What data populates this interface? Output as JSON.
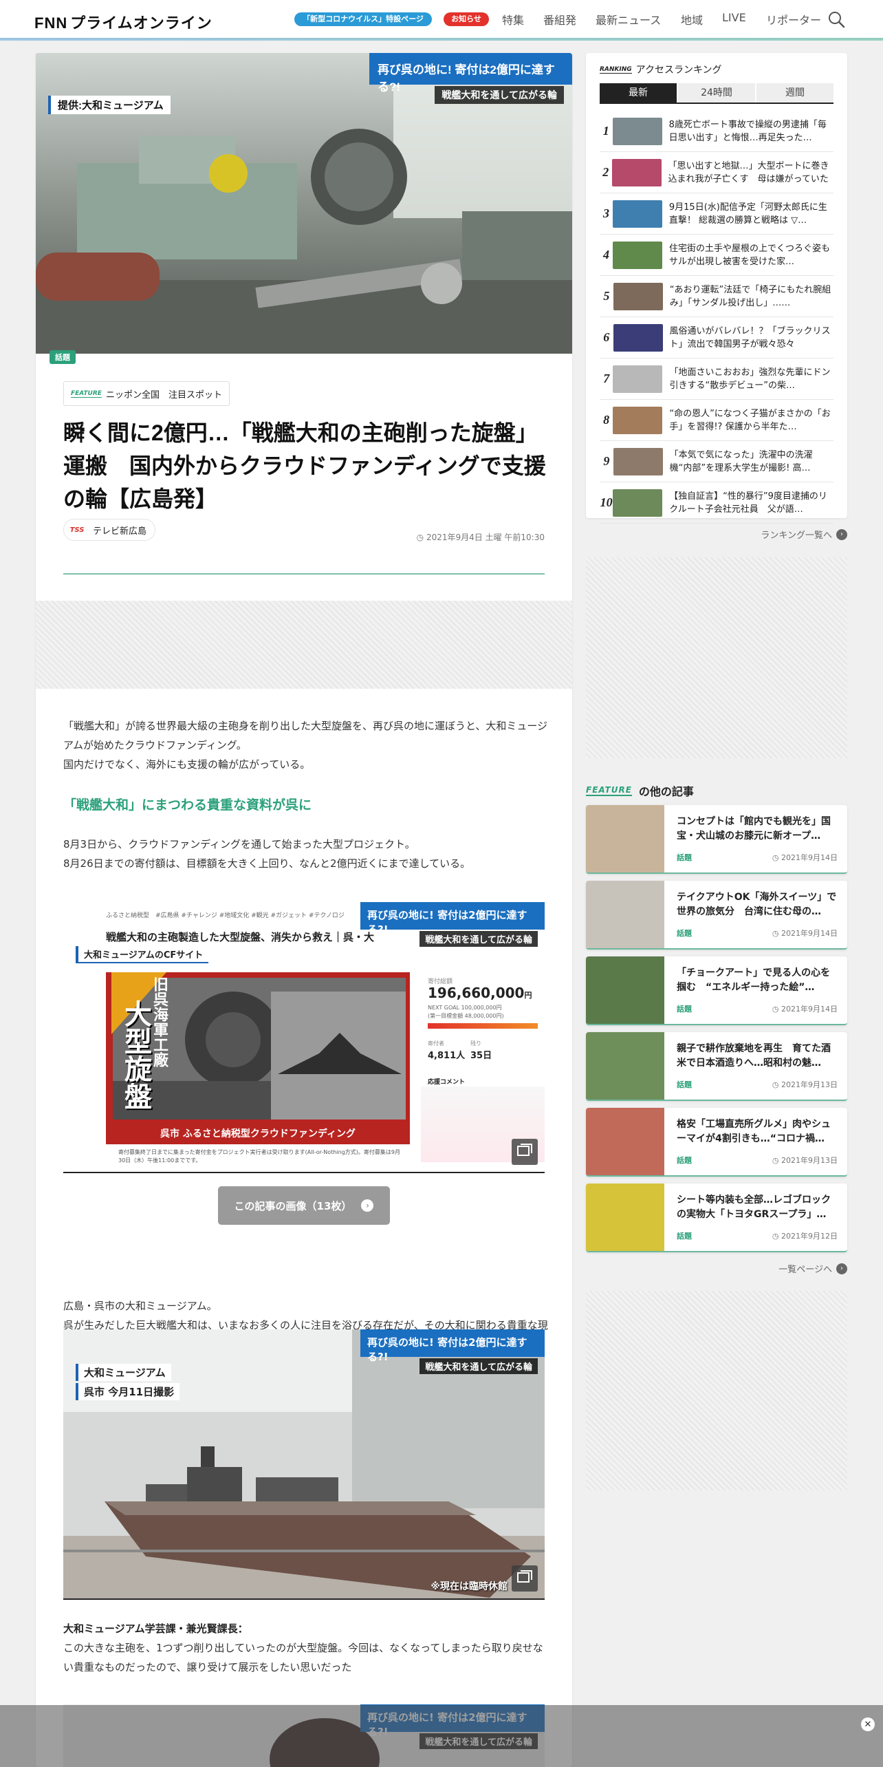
{
  "header": {
    "logo_fnn": "FNN",
    "logo_text": "プライムオンライン",
    "corona_pill": "「新型コロナウイルス」特設ページ",
    "notice_pill": "お知らせ",
    "nav": [
      "特集",
      "番組発",
      "最新ニュース",
      "地域",
      "LIVE",
      "リポーター"
    ]
  },
  "article": {
    "hero": {
      "caption": "提供:大和ミュージアム",
      "banner": "再び呉の地に! 寄付は2億円に達する?!",
      "banner_sub": "戦艦大和を通して広がる輪",
      "topic_badge": "話題"
    },
    "feature_label": "FEATURE",
    "feature_tag": "ニッポン全国　注目スポット",
    "title": "瞬く間に2億円…「戦艦大和の主砲削った旋盤」運搬　国内外からクラウドファンディングで支援の輪【広島発】",
    "source": "テレビ新広島",
    "source_logo": "TSS",
    "date": "2021年9月4日 土曜 午前10:30",
    "lead": "「戦艦大和」が誇る世界最大級の主砲身を削り出した大型旋盤を、再び呉の地に運ぼうと、大和ミュージアムが始めたクラウドファンディング。\n国内だけでなく、海外にも支援の輪が広がっている。",
    "subhead": "「戦艦大和」にまつわる貴重な資料が呉に",
    "para2": "8月3日から、クラウドファンディングを通して始まった大型プロジェクト。\n8月26日までの寄付額は、目標額を大きく上回り、なんと2億円近くにまで達している。",
    "cf_image": {
      "tags": "ふるさと納税型　#広島県 #チャレンジ #地域文化 #観光 #ガジェット #テクノロジ",
      "headline": "戦艦大和の主砲製造した大型旋盤、消失から救え｜呉・大",
      "site_label": "大和ミュージアムのCFサイト",
      "panel_side": "旧呉海軍工廠",
      "panel_big": "大型旋盤",
      "panel_bottom": "呉市 ふるさと納税型クラウドファンディング",
      "amount_label": "寄付総額",
      "amount": "196,660,000",
      "amount_unit": "円",
      "next_goal": "NEXT GOAL 100,000,000円",
      "first_goal": "(第一目標金額 48,000,000円)",
      "supporters_label": "寄付者",
      "supporters": "4,811人",
      "remaining_label": "残り",
      "remaining": "35日",
      "comment_label": "応援コメント",
      "fine_print": "寄付募集終了日までに集まった寄付金をプロジェクト実行者は受け取ります(All-or-Nothing方式)。寄付募集は9月30日（木）午後11:00までです。"
    },
    "image_count_btn": "この記事の画像（13枚）",
    "para3": "広島・呉市の大和ミュージアム。\n呉が生みだした巨大戦艦大和は、いまなお多くの人に注目を浴びる存在だが、その大和に関わる貴重な現物資料が呉市にやってくる。",
    "museum_image": {
      "label1": "大和ミュージアム",
      "label2": "呉市 今月11日撮影",
      "note": "※現在は臨時休館"
    },
    "speaker": "大和ミュージアム学芸課・兼光賢課長：",
    "quote": "この大きな主砲を、1つずつ削り出していったのが大型旋盤。今回は、なくなってしまったら取り戻せない貴重なものだったので、譲り受けて展示をしたい思いだった"
  },
  "ranking": {
    "label": "RANKING",
    "title": "アクセスランキング",
    "tabs": [
      "最新",
      "24時間",
      "週間"
    ],
    "items": [
      {
        "rank": "1",
        "text": "8歳死亡ボート事故で操縦の男逮捕「毎日思い出す」と悔恨…再足失った…"
      },
      {
        "rank": "2",
        "text": "「思い出すと地獄…」大型ボートに巻き込まれ我が子亡くす　母は嫌がっていた"
      },
      {
        "rank": "3",
        "text": "9月15日(水)配信予定「河野太郎氏に生直撃！ 総裁選の勝算と戦略は ▽…"
      },
      {
        "rank": "4",
        "text": "住宅街の土手や屋根の上でくつろぐ姿も　サルが出現し被害を受けた家…"
      },
      {
        "rank": "5",
        "text": "“あおり運転”法廷で「椅子にもたれ腕組み」「サンダル投げ出し」……"
      },
      {
        "rank": "6",
        "text": "風俗通いがバレバレ！？「ブラックリスト」流出で韓国男子が戦々恐々"
      },
      {
        "rank": "7",
        "text": "「地面さいこおおお」強烈な先輩にドン引きする“散歩デビュー”の柴…"
      },
      {
        "rank": "8",
        "text": "“命の恩人”になつく子猫がまさかの「お手」を習得!? 保護から半年た…"
      },
      {
        "rank": "9",
        "text": "「本気で気になった」洗濯中の洗濯機“内部”を理系大学生が撮影! 高…"
      },
      {
        "rank": "10",
        "text": "【独自証言】“性的暴行”9度目逮捕のリクルート子会社元社員　父が語…"
      }
    ],
    "more": "ランキング一覧へ"
  },
  "features": {
    "label": "FEATURE",
    "title": "の他の記事",
    "items": [
      {
        "title": "コンセプトは「館内でも観光を」国宝・犬山城のお膝元に新オープ…",
        "category": "話題",
        "date": "2021年9月14日"
      },
      {
        "title": "テイクアウトOK「海外スイーツ」で世界の旅気分　台湾に住む母の…",
        "category": "話題",
        "date": "2021年9月14日"
      },
      {
        "title": "「チョークアート」で見る人の心を掴む　“エネルギー持った絵”…",
        "category": "話題",
        "date": "2021年9月14日"
      },
      {
        "title": "親子で耕作放棄地を再生　育てた酒米で日本酒造りへ…昭和村の魅…",
        "category": "話題",
        "date": "2021年9月13日"
      },
      {
        "title": "格安「工場直売所グルメ」肉やシューマイが4割引きも…“コロナ禍…",
        "category": "話題",
        "date": "2021年9月13日"
      },
      {
        "title": "シート等内装も全部…レゴブロックの実物大「トヨタGRスープラ」…",
        "category": "話題",
        "date": "2021年9月12日"
      }
    ],
    "more": "一覧ページへ"
  },
  "colors": {
    "accent_green": "#2ba07a",
    "corona_blue": "#2a9bd6",
    "notice_red": "#e2322b",
    "banner_blue": "#1b6fc0"
  }
}
